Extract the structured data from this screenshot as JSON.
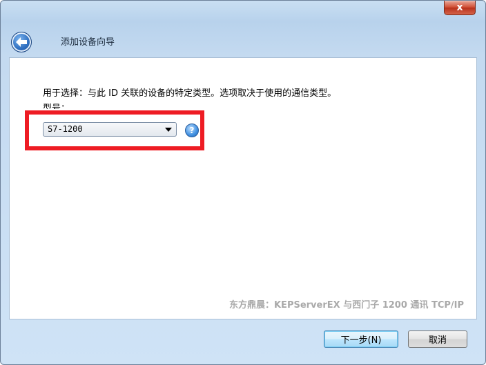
{
  "window": {
    "close_label": "x"
  },
  "header": {
    "title": "添加设备向导"
  },
  "content": {
    "description": "用于选择：与此 ID 关联的设备的特定类型。选项取决于使用的通信类型。",
    "model_label": "型号：",
    "model_value": "S7-1200",
    "help_symbol": "?",
    "watermark": "东方鼎晨：KEPServerEX 与西门子 1200 通讯 TCP/IP"
  },
  "footer": {
    "next_label": "下一步(N)",
    "cancel_label": "取消"
  },
  "colors": {
    "highlight": "#ee1c24",
    "accent": "#2f6fc0"
  }
}
